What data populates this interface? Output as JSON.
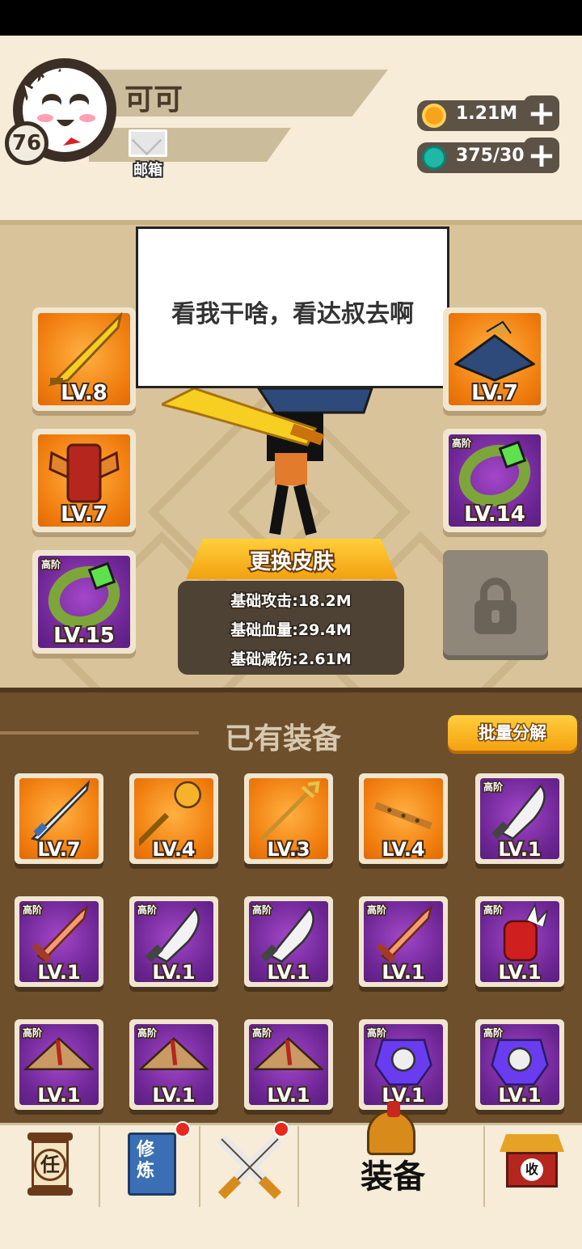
{
  "player": {
    "name": "可可",
    "level": "76",
    "mail_label": "邮箱"
  },
  "resources": {
    "coins": "1.21M",
    "gems": "375/30"
  },
  "bubble_text": "看我干啥，看达叔去啊",
  "equipped": {
    "weapon": {
      "level": "LV.8",
      "rarity": "orange"
    },
    "hat": {
      "level": "LV.7",
      "rarity": "orange"
    },
    "armor": {
      "level": "LV.7",
      "rarity": "orange"
    },
    "ring_right": {
      "level": "LV.14",
      "rarity": "purple",
      "tier": "高阶"
    },
    "ring_left": {
      "level": "LV.15",
      "rarity": "purple",
      "tier": "高阶"
    }
  },
  "change_skin_label": "更换皮肤",
  "stats": {
    "attack": "基础攻击:18.2M",
    "hp": "基础血量:29.4M",
    "reduction": "基础减伤:2.61M"
  },
  "inventory": {
    "title": "已有装备",
    "bulk_label": "批量分解",
    "items": [
      {
        "icon": "sword-icon",
        "level": "LV.7",
        "rarity": "orange",
        "tier": ""
      },
      {
        "icon": "mace-icon",
        "level": "LV.4",
        "rarity": "orange",
        "tier": ""
      },
      {
        "icon": "trident-spear-icon",
        "level": "LV.3",
        "rarity": "orange",
        "tier": ""
      },
      {
        "icon": "flute-icon",
        "level": "LV.4",
        "rarity": "orange",
        "tier": ""
      },
      {
        "icon": "broadsword-icon",
        "level": "LV.1",
        "rarity": "purple",
        "tier": "高阶"
      },
      {
        "icon": "wooden-sword-icon",
        "level": "LV.1",
        "rarity": "purple",
        "tier": "高阶"
      },
      {
        "icon": "broadsword-icon",
        "level": "LV.1",
        "rarity": "purple",
        "tier": "高阶"
      },
      {
        "icon": "broadsword-icon",
        "level": "LV.1",
        "rarity": "purple",
        "tier": "高阶"
      },
      {
        "icon": "wooden-sword-icon",
        "level": "LV.1",
        "rarity": "purple",
        "tier": "高阶"
      },
      {
        "icon": "spiked-gauntlet-icon",
        "level": "LV.1",
        "rarity": "purple",
        "tier": "高阶"
      },
      {
        "icon": "straw-hat-icon",
        "level": "LV.1",
        "rarity": "purple",
        "tier": "高阶"
      },
      {
        "icon": "straw-hat-icon",
        "level": "LV.1",
        "rarity": "purple",
        "tier": "高阶"
      },
      {
        "icon": "straw-hat-icon",
        "level": "LV.1",
        "rarity": "purple",
        "tier": "高阶"
      },
      {
        "icon": "orb-armor-icon",
        "level": "LV.1",
        "rarity": "purple",
        "tier": "高阶"
      },
      {
        "icon": "orb-armor-icon",
        "level": "LV.1",
        "rarity": "purple",
        "tier": "高阶"
      }
    ]
  },
  "nav": {
    "task_glyph": "任",
    "cultivate_glyph": "修炼",
    "equip_label": "装备",
    "collect_glyph": "收"
  },
  "colors": {
    "orange": "#f07d0e",
    "purple": "#6c2593",
    "gold": "#f3a10f",
    "notify": "#e8281d"
  }
}
